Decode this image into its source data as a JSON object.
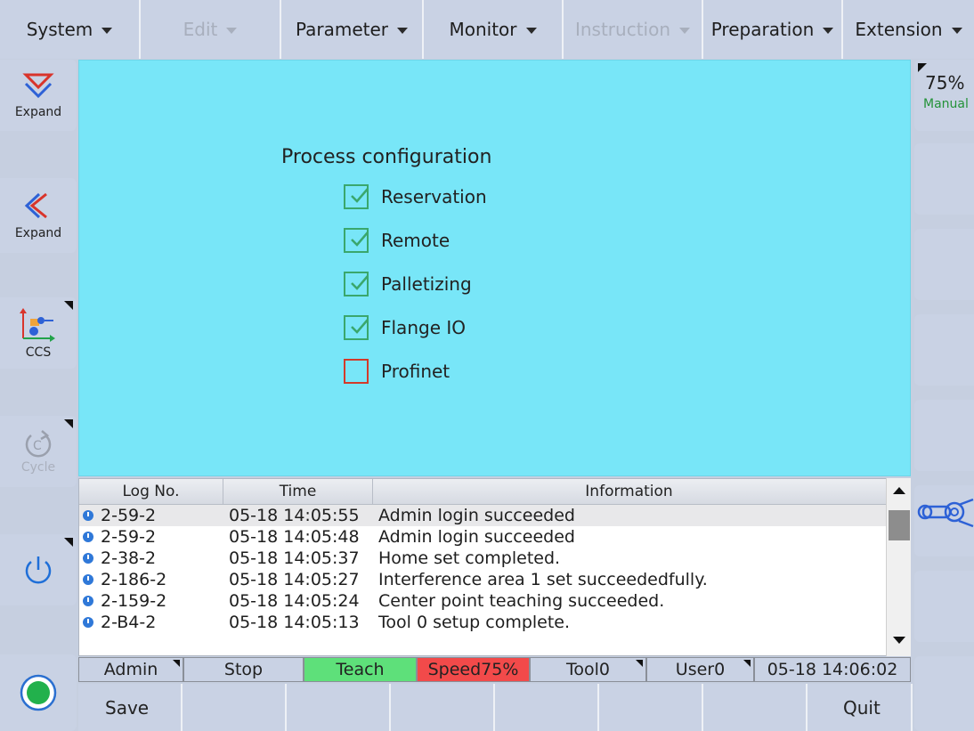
{
  "menu": [
    {
      "label": "System",
      "disabled": false
    },
    {
      "label": "Edit",
      "disabled": true
    },
    {
      "label": "Parameter",
      "disabled": false
    },
    {
      "label": "Monitor",
      "disabled": false
    },
    {
      "label": "Instruction",
      "disabled": true
    },
    {
      "label": "Preparation",
      "disabled": false
    },
    {
      "label": "Extension",
      "disabled": false
    }
  ],
  "left_panel": {
    "expand_down_label": "Expand",
    "expand_left_label": "Expand",
    "ccs_label": "CCS",
    "cycle_label": "Cycle"
  },
  "right_panel": {
    "speed": "75%",
    "mode": "Manual"
  },
  "process_config": {
    "title": "Process configuration",
    "items": [
      {
        "label": "Reservation",
        "checked": true
      },
      {
        "label": "Remote",
        "checked": true
      },
      {
        "label": "Palletizing",
        "checked": true
      },
      {
        "label": "Flange IO",
        "checked": true
      },
      {
        "label": "Profinet",
        "checked": false
      }
    ]
  },
  "log": {
    "headers": [
      "Log No.",
      "Time",
      "Information"
    ],
    "rows": [
      {
        "no": "2-59-2",
        "time": "05-18 14:05:55",
        "info": "Admin  login succeeded"
      },
      {
        "no": "2-59-2",
        "time": "05-18 14:05:48",
        "info": "Admin  login succeeded"
      },
      {
        "no": "2-38-2",
        "time": "05-18 14:05:37",
        "info": "Home set completed."
      },
      {
        "no": "2-186-2",
        "time": "05-18 14:05:27",
        "info": "Interference area 1 set succeededfully."
      },
      {
        "no": "2-159-2",
        "time": "05-18 14:05:24",
        "info": "Center point teaching succeeded."
      },
      {
        "no": "2-B4-2",
        "time": "05-18 14:05:13",
        "info": "Tool 0 setup complete."
      }
    ]
  },
  "status_bar": {
    "user": "Admin",
    "state": "Stop",
    "mode": "Teach",
    "speed": "Speed75%",
    "tool": "Tool0",
    "coord": "User0",
    "datetime": "05-18 14:06:02",
    "colors": {
      "teach": "#5ee07a",
      "speed": "#f24a4a"
    }
  },
  "softkeys": {
    "save": "Save",
    "quit": "Quit"
  },
  "colors": {
    "main_bg": "#78e6f8",
    "button_bg": "#c9d2e4",
    "check_on": "#3aa76d",
    "check_off": "#d33a2a"
  }
}
